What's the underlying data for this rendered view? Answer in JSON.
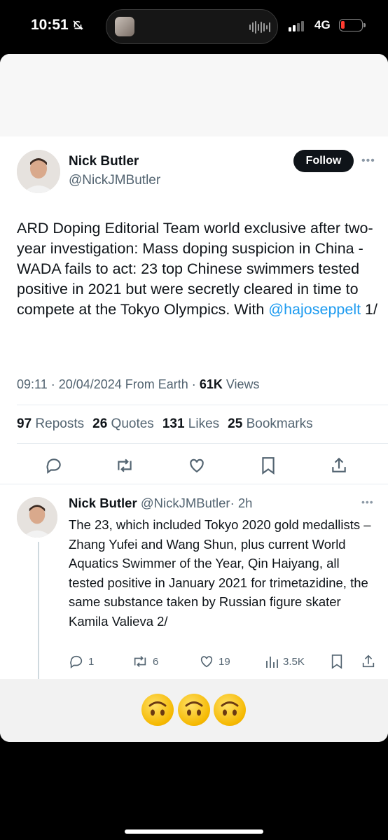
{
  "status_bar": {
    "time": "10:51",
    "network": "4G"
  },
  "tweet": {
    "author_name": "Nick Butler",
    "author_handle": "@NickJMButler",
    "follow_label": "Follow",
    "text_before": "ARD Doping Editorial Team world exclusive after two-year investigation: Mass doping suspicion in China - WADA fails to act: 23 top Chinese swimmers tested positive in 2021 but were secretly cleared in time to compete at the Tokyo Olympics. With ",
    "mention": "@hajoseppelt",
    "text_after": " 1/",
    "timestamp": "09:11 · 20/04/2024 From Earth · ",
    "views_count": "61K",
    "views_label": " Views",
    "stats": [
      {
        "count": "97",
        "label": "Reposts"
      },
      {
        "count": "26",
        "label": "Quotes"
      },
      {
        "count": "131",
        "label": "Likes"
      },
      {
        "count": "25",
        "label": "Bookmarks"
      }
    ]
  },
  "reply": {
    "author_name": "Nick Butler",
    "author_handle": "@NickJMButler",
    "time": "· 2h",
    "text": "The 23, which included Tokyo 2020 gold medallists – Zhang Yufei and Wang Shun, plus current World Aquatics Swimmer of the Year, Qin Haiyang, all tested positive in January 2021 for trimetazidine, the same substance taken by Russian figure skater Kamila Valieva 2/",
    "replies": "1",
    "reposts": "6",
    "likes": "19",
    "views": "3.5K"
  },
  "colors": {
    "accent": "#1d9bf0",
    "text": "#0f1419",
    "muted": "#536471",
    "battery_low": "#ff3b30"
  },
  "icons": [
    "mute-bell-icon",
    "signal-icon",
    "battery-icon",
    "more-icon",
    "reply-icon",
    "repost-icon",
    "like-icon",
    "bookmark-icon",
    "share-icon",
    "views-icon",
    "upside-down-face-emoji"
  ]
}
